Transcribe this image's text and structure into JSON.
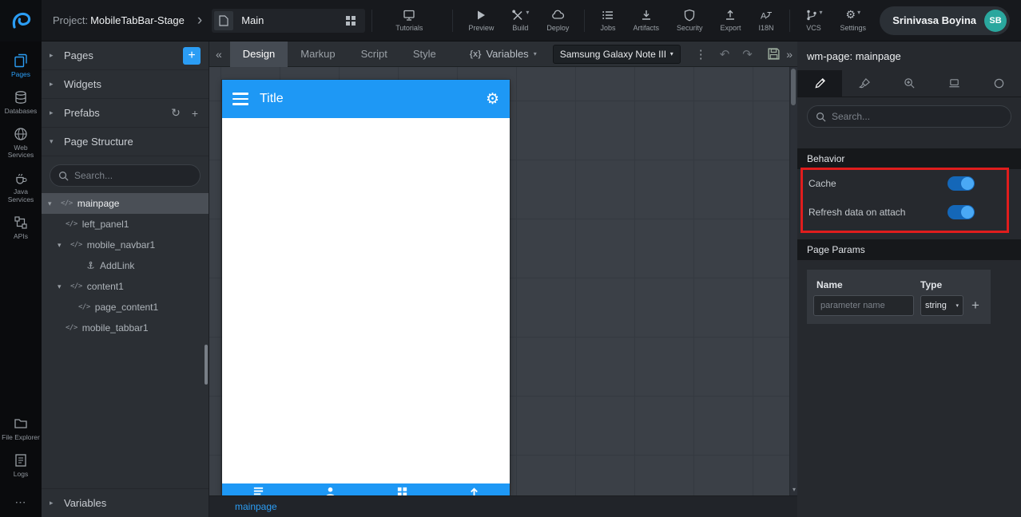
{
  "colors": {
    "accent_blue": "#2b9df4",
    "phone_header_blue": "#1e98f5",
    "annotation_red": "#e01d1d",
    "avatar_teal": "#2aa79e",
    "toggle_track": "#1467b8",
    "toggle_knob": "#4aa9f5"
  },
  "icons": {
    "plus": "+",
    "refresh": "↻",
    "collapse_left": "«",
    "collapse_right": "»",
    "kebab": "⋮",
    "undo": "↶",
    "redo": "↷",
    "caret_down": "▾",
    "caret_right": "▸",
    "chevron_right": "›",
    "gear": "⚙",
    "dots": "⋯"
  },
  "topbar": {
    "project_label": "Project:",
    "project_name": "MobileTabBar-Stage",
    "page_selector": {
      "value": "Main"
    },
    "menu": [
      {
        "label": "Tutorials"
      },
      {
        "label": "Preview"
      },
      {
        "label": "Build"
      },
      {
        "label": "Deploy"
      },
      {
        "label": "Jobs"
      },
      {
        "label": "Artifacts"
      },
      {
        "label": "Security"
      },
      {
        "label": "Export"
      },
      {
        "label": "I18N"
      },
      {
        "label": "VCS"
      },
      {
        "label": "Settings"
      }
    ],
    "user": {
      "name": "Srinivasa Boyina",
      "initials": "SB"
    }
  },
  "left_rail": {
    "items": [
      {
        "label": "Pages",
        "active": true
      },
      {
        "label": "Databases",
        "active": false
      },
      {
        "label": "Web Services",
        "active": false
      },
      {
        "label": "Java Services",
        "active": false
      },
      {
        "label": "APIs",
        "active": false
      },
      {
        "label": "File Explorer",
        "active": false
      },
      {
        "label": "Logs",
        "active": false
      }
    ]
  },
  "left_panel": {
    "pages_header": "Pages",
    "widgets_header": "Widgets",
    "prefabs_header": "Prefabs",
    "page_structure_header": "Page Structure",
    "variables_header": "Variables",
    "search_placeholder": "Search...",
    "tree": [
      {
        "label": "mainpage",
        "selected": true,
        "expanded": true
      },
      {
        "label": "left_panel1"
      },
      {
        "label": "mobile_navbar1",
        "expanded": true
      },
      {
        "label": "AddLink"
      },
      {
        "label": "content1",
        "expanded": true
      },
      {
        "label": "page_content1"
      },
      {
        "label": "mobile_tabbar1"
      }
    ]
  },
  "editor": {
    "tabs": {
      "design": "Design",
      "markup": "Markup",
      "script": "Script",
      "style": "Style"
    },
    "active_tab": "Design",
    "variables_glyph": "{x}",
    "variables_label": "Variables",
    "device": "Samsung Galaxy Note III",
    "open_page_tab": "mainpage",
    "phone": {
      "title": "Title"
    }
  },
  "right_panel": {
    "title": "wm-page: mainpage",
    "search_placeholder": "Search...",
    "behavior_header": "Behavior",
    "toggles": [
      {
        "label": "Cache",
        "state": "on"
      },
      {
        "label": "Refresh data on attach",
        "state": "on"
      }
    ],
    "page_params_header": "Page Params",
    "params_table": {
      "name_header": "Name",
      "type_header": "Type",
      "name_placeholder": "parameter name",
      "type_value": "string"
    }
  }
}
